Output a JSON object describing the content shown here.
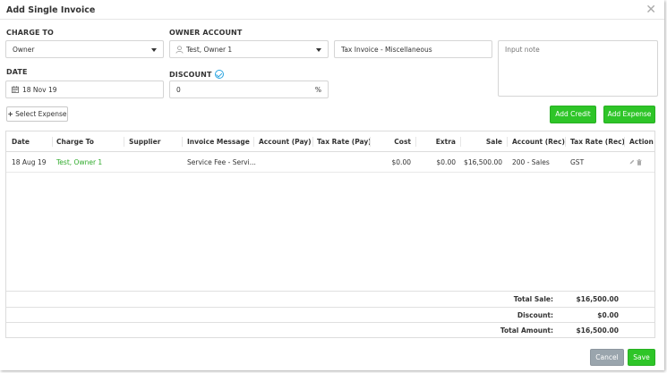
{
  "modal": {
    "title": "Add Single Invoice"
  },
  "form": {
    "charge_to": {
      "label": "CHARGE TO",
      "value": "Owner"
    },
    "owner_account": {
      "label": "OWNER ACCOUNT",
      "value": "Test, Owner 1",
      "icon": "user-icon"
    },
    "invoice_type": {
      "value": "Tax Invoice - Miscellaneous"
    },
    "note": {
      "placeholder": "Input note"
    },
    "date": {
      "label": "DATE",
      "value": "18 Nov 19",
      "icon": "calendar-icon"
    },
    "discount": {
      "label": "DISCOUNT",
      "value": "0",
      "suffix": "%"
    }
  },
  "actions": {
    "select_expense": "Select Expense",
    "add_credit": "Add Credit",
    "add_expense": "Add Expense"
  },
  "table": {
    "columns": [
      "Date",
      "Charge To",
      "Supplier",
      "Invoice Message",
      "Account (Pay)",
      "Tax Rate (Pay)",
      "Cost",
      "Extra",
      "Sale",
      "Account (Rec)",
      "Tax Rate (Rec)",
      "Action"
    ],
    "rows": [
      {
        "date": "18 Aug 19",
        "charge_to": "Test, Owner 1",
        "supplier": "",
        "message": "Service Fee - Servi...",
        "account_pay": "",
        "tax_pay": "",
        "cost": "$0.00",
        "extra": "$0.00",
        "sale": "$16,500.00",
        "account_rec": "200 - Sales",
        "tax_rec": "GST"
      }
    ]
  },
  "totals": {
    "total_sale_label": "Total Sale:",
    "total_sale": "$16,500.00",
    "discount_label": "Discount:",
    "discount": "$0.00",
    "total_amount_label": "Total Amount:",
    "total_amount": "$16,500.00"
  },
  "footer": {
    "cancel": "Cancel",
    "save": "Save"
  },
  "colors": {
    "accent_green": "#2ec528",
    "charge_to_text": "#2eaa2a",
    "check_blue": "#2aa4e0",
    "cancel_grey": "#9aa5ad"
  }
}
